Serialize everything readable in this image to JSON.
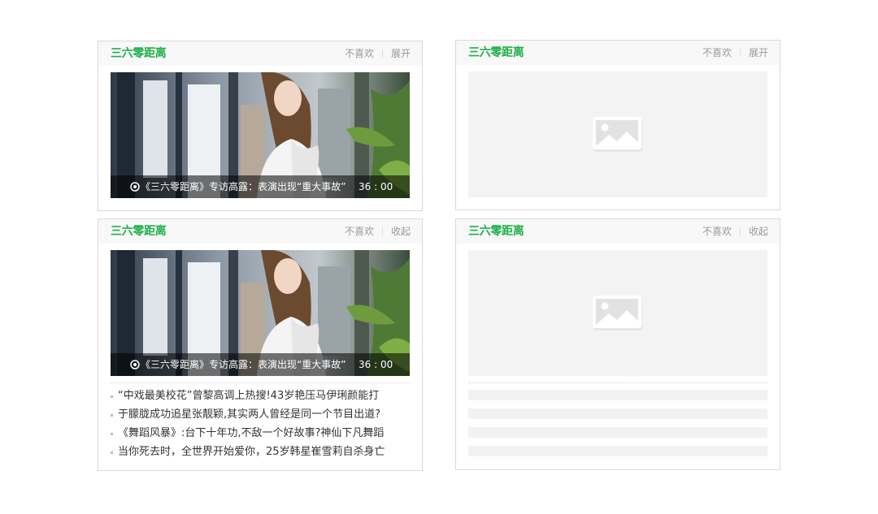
{
  "cards": [
    {
      "title": "三六零距离",
      "dislike_label": "不喜欢",
      "toggle_label": "展开",
      "video": {
        "caption": "《三六零距离》专访高露：表演出现“重大事故”",
        "duration": "36 : 00"
      }
    },
    {
      "title": "三六零距离",
      "dislike_label": "不喜欢",
      "toggle_label": "展开"
    },
    {
      "title": "三六零距离",
      "dislike_label": "不喜欢",
      "toggle_label": "收起",
      "video": {
        "caption": "《三六零距离》专访高露：表演出现“重大事故”",
        "duration": "36 : 00"
      },
      "news": [
        "“中戏最美校花”曾黎高调上热搜!43岁艳压马伊琍颜能打",
        "于朦胧成功追星张靓颖,其实两人曾经是同一个节目出道?",
        "《舞蹈风暴》:台下十年功,不敌一个好故事?神仙下凡舞蹈",
        "当你死去时，全世界开始爱你，25岁韩星崔雪莉自杀身亡"
      ]
    },
    {
      "title": "三六零距离",
      "dislike_label": "不喜欢",
      "toggle_label": "收起"
    }
  ],
  "colors": {
    "accent": "#1eb04a",
    "muted_text": "#999999",
    "placeholder_bg": "#f3f3f3"
  },
  "icons": [
    "play-circle-icon",
    "image-placeholder-icon"
  ]
}
